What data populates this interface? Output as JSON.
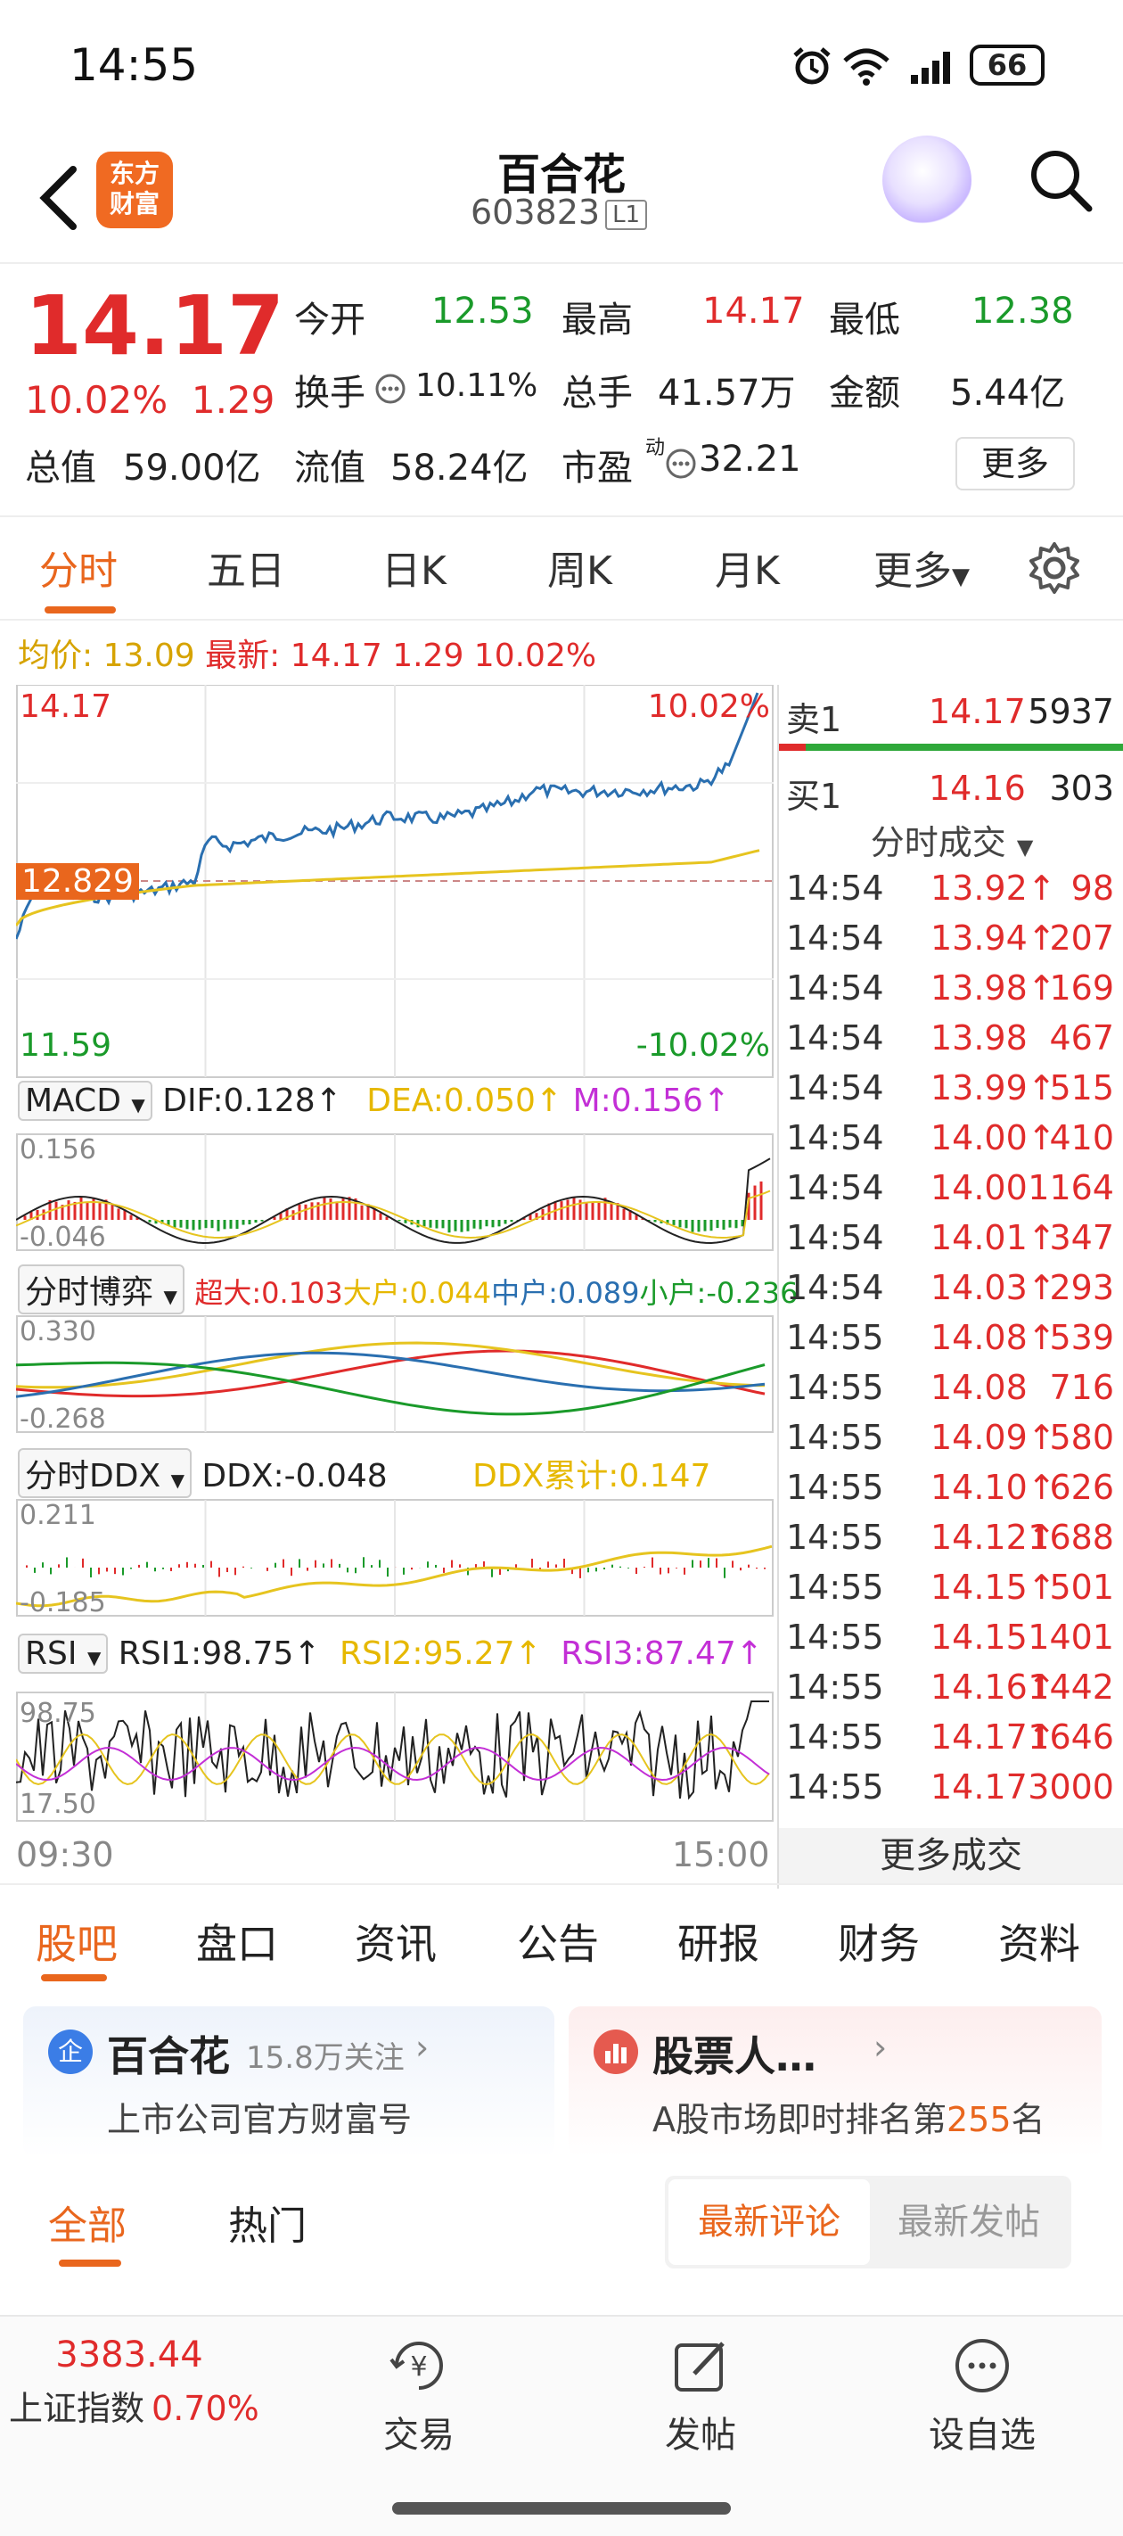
{
  "status": {
    "time": "14:55",
    "battery": "66"
  },
  "header": {
    "title": "百合花",
    "code": "603823",
    "level": "L1",
    "logo_text": "东方财富"
  },
  "quote": {
    "price": "14.17",
    "pct": "10.02%",
    "change": "1.29",
    "open_label": "今开",
    "open": "12.53",
    "high_label": "最高",
    "high": "14.17",
    "low_label": "最低",
    "low": "12.38",
    "turnover_label": "换手",
    "turnover": "10.11%",
    "volume_label": "总手",
    "volume": "41.57万",
    "amount_label": "金额",
    "amount": "5.44亿",
    "mcap_label": "总值",
    "mcap": "59.00亿",
    "float_label": "流值",
    "float": "58.24亿",
    "pe_label": "市盈",
    "pe_sup": "动",
    "pe": "32.21",
    "more": "更多"
  },
  "tabs": [
    "分时",
    "五日",
    "日K",
    "周K",
    "月K",
    "更多"
  ],
  "avgline": {
    "avg_label": "均价:",
    "avg": "13.09",
    "latest_label": "最新:",
    "latest": "14.17 1.29 10.02%"
  },
  "chart": {
    "top_price": "14.17",
    "top_pct": "10.02%",
    "bot_price": "11.59",
    "bot_pct": "-10.02%",
    "prev_close": "12.829",
    "time_start": "09:30",
    "time_end": "15:00",
    "colors": {
      "price": "#2a6fb0",
      "avg": "#e6c41f",
      "up": "#e02b2b",
      "down": "#1a9a2a"
    }
  },
  "macd": {
    "name": "MACD",
    "dif": "DIF:0.128↑",
    "dea": "DEA:0.050↑",
    "m": "M:0.156↑",
    "top": "0.156",
    "bot": "-0.046"
  },
  "bo": {
    "name": "分时博弈",
    "a": "超大:0.103",
    "b": "大户:0.044",
    "c": "中户:0.089",
    "d": "小户:-0.236",
    "top": "0.330",
    "bot": "-0.268"
  },
  "ddx": {
    "name": "分时DDX",
    "a": "DDX:-0.048",
    "b": "DDX累计:0.147",
    "top": "0.211",
    "bot": "-0.185"
  },
  "rsi": {
    "name": "RSI",
    "a": "RSI1:98.75↑",
    "b": "RSI2:95.27↑",
    "c": "RSI3:87.47↑",
    "top": "98.75",
    "bot": "17.50"
  },
  "book": {
    "sell_label": "卖1",
    "sell_price": "14.17",
    "sell_vol": "5937",
    "buy_label": "买1",
    "buy_price": "14.16",
    "buy_vol": "303",
    "trades_title": "分时成交",
    "trades": [
      {
        "t": "14:54",
        "p": "13.92↑",
        "v": "98"
      },
      {
        "t": "14:54",
        "p": "13.94↑",
        "v": "207"
      },
      {
        "t": "14:54",
        "p": "13.98↑",
        "v": "169"
      },
      {
        "t": "14:54",
        "p": "13.98",
        "v": "467"
      },
      {
        "t": "14:54",
        "p": "13.99↑",
        "v": "515"
      },
      {
        "t": "14:54",
        "p": "14.00↑",
        "v": "410"
      },
      {
        "t": "14:54",
        "p": "14.00",
        "v": "1164"
      },
      {
        "t": "14:54",
        "p": "14.01↑",
        "v": "347"
      },
      {
        "t": "14:54",
        "p": "14.03↑",
        "v": "293"
      },
      {
        "t": "14:55",
        "p": "14.08↑",
        "v": "539"
      },
      {
        "t": "14:55",
        "p": "14.08",
        "v": "716"
      },
      {
        "t": "14:55",
        "p": "14.09↑",
        "v": "580"
      },
      {
        "t": "14:55",
        "p": "14.10↑",
        "v": "626"
      },
      {
        "t": "14:55",
        "p": "14.12↑",
        "v": "1688"
      },
      {
        "t": "14:55",
        "p": "14.15↑",
        "v": "501"
      },
      {
        "t": "14:55",
        "p": "14.15",
        "v": "1401"
      },
      {
        "t": "14:55",
        "p": "14.16↑",
        "v": "1442"
      },
      {
        "t": "14:55",
        "p": "14.17↑",
        "v": "1646"
      },
      {
        "t": "14:55",
        "p": "14.17",
        "v": "3000"
      }
    ],
    "more_trades": "更多成交"
  },
  "section_tabs": [
    "股吧",
    "盘口",
    "资讯",
    "公告",
    "研报",
    "财务",
    "资料"
  ],
  "cards": {
    "left_badge": "企",
    "left_title": "百合花",
    "left_follow": "15.8万关注",
    "left_sub": "上市公司官方财富号",
    "right_title": "股票人…",
    "right_sub_a": "A股市场即时排名第",
    "right_rank": "255",
    "right_sub_b": "名"
  },
  "feed": {
    "all": "全部",
    "hot": "热门",
    "latest_comment": "最新评论",
    "latest_post": "最新发帖"
  },
  "bottom": {
    "index_value": "3383.44",
    "index_name": "上证指数",
    "index_pct": "0.70%",
    "trade": "交易",
    "post": "发帖",
    "watch": "设自选",
    "yen": "¥"
  }
}
